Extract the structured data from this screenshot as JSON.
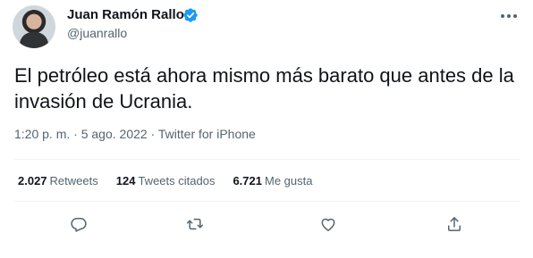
{
  "author": {
    "name": "Juan Ramón Rallo",
    "handle": "@juanrallo",
    "verified": true
  },
  "tweet": {
    "text": "El petróleo está ahora mismo más barato que antes de la invasión de Ucrania.",
    "time": "1:20 p. m.",
    "separator1": " · ",
    "date": "5 ago. 2022",
    "separator2": " · ",
    "source": "Twitter for iPhone"
  },
  "stats": {
    "retweets_count": "2.027",
    "retweets_label": "Retweets",
    "quotes_count": "124",
    "quotes_label": "Tweets citados",
    "likes_count": "6.721",
    "likes_label": "Me gusta"
  },
  "colors": {
    "text": "#0f1419",
    "secondary": "#536471",
    "verified": "#1d9bf0",
    "divider": "#eff3f4"
  },
  "icons": [
    "verified-badge-icon",
    "more-icon",
    "reply-icon",
    "retweet-icon",
    "like-icon",
    "share-icon"
  ]
}
